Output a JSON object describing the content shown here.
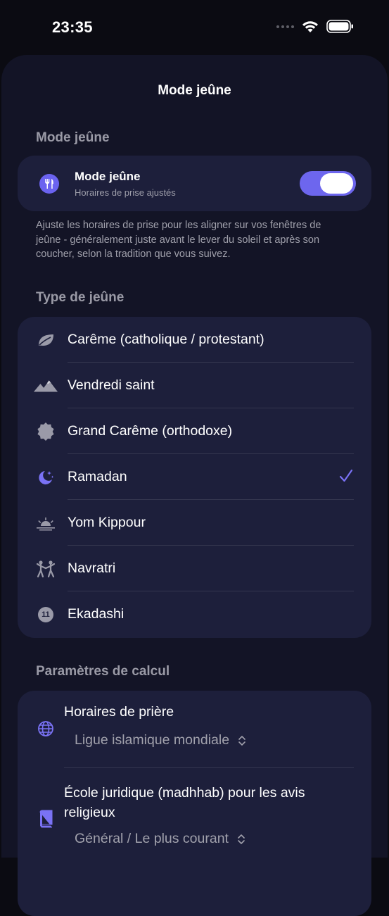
{
  "status_bar": {
    "time": "23:35"
  },
  "sheet": {
    "title": "Mode jeûne"
  },
  "section_fasting_mode": {
    "header": "Mode jeûne",
    "toggle_title": "Mode jeûne",
    "toggle_subtitle": "Horaires de prise ajustés",
    "toggle_on": true,
    "description": "Ajuste les horaires de prise pour les aligner sur vos fenêtres de jeûne - généralement juste avant le lever du soleil et après son coucher, selon la tradition que vous suivez."
  },
  "section_fast_type": {
    "header": "Type de jeûne",
    "items": [
      {
        "label": "Carême (catholique / protestant)",
        "icon": "leaf-icon",
        "selected": false
      },
      {
        "label": "Vendredi saint",
        "icon": "mountains-icon",
        "selected": false
      },
      {
        "label": "Grand Carême (orthodoxe)",
        "icon": "seal-icon",
        "selected": false
      },
      {
        "label": "Ramadan",
        "icon": "moon-stars-icon",
        "selected": true
      },
      {
        "label": "Yom Kippour",
        "icon": "sunset-icon",
        "selected": false
      },
      {
        "label": "Navratri",
        "icon": "dancers-icon",
        "selected": false
      },
      {
        "label": "Ekadashi",
        "icon": "eleven-circle-icon",
        "selected": false,
        "icon_text": "11"
      }
    ]
  },
  "section_calc": {
    "header": "Paramètres de calcul",
    "prayer_times": {
      "title": "Horaires de prière",
      "value": "Ligue islamique mondiale"
    },
    "madhhab": {
      "title": "École juridique (madhhab) pour les avis religieux",
      "value": "Général / Le plus courant"
    }
  },
  "colors": {
    "accent": "#6d66ee",
    "sheet_bg": "#131426",
    "card_bg": "#1d1f3b",
    "secondary_text": "#a1a1ac"
  }
}
